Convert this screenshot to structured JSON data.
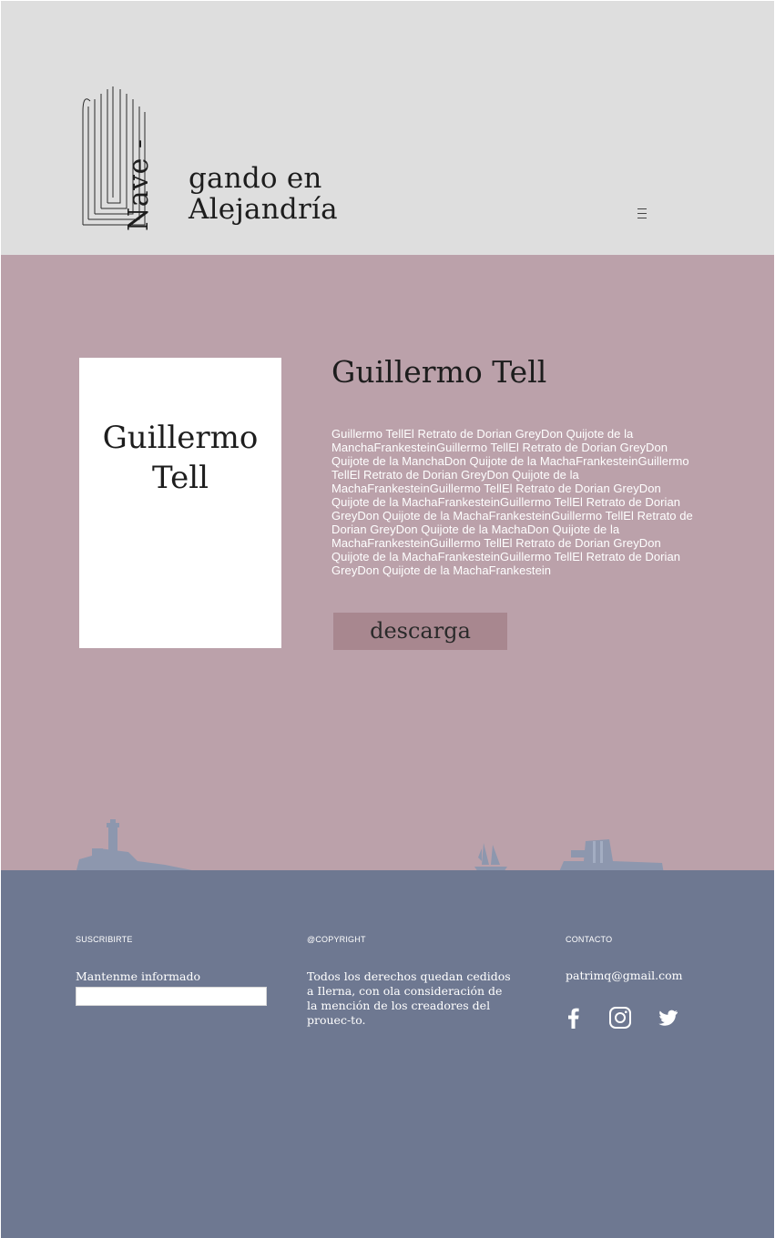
{
  "brand": {
    "vertical": "Nave -",
    "line1": "gando en",
    "line2": "Alejandría"
  },
  "book": {
    "cover_title": "Guillermo Tell",
    "title": "Guillermo Tell",
    "description": "Guillermo TellEl Retrato de Dorian GreyDon Quijote de la ManchaFrankesteinGuillermo TellEl Retrato de Dorian GreyDon Quijote de la ManchaDon Quijote de la MachaFrankesteinGuillermo TellEl Retrato de Dorian GreyDon Quijote de la MachaFrankesteinGuillermo TellEl Retrato de Dorian GreyDon Quijote de la MachaFrankesteinGuillermo TellEl Retrato de Dorian GreyDon Quijote de la MachaFrankesteinGuillermo TellEl Retrato de Dorian GreyDon Quijote de la MachaDon Quijote de la MachaFrankesteinGuillermo TellEl Retrato de Dorian GreyDon Quijote de la MachaFrankesteinGuillermo TellEl Retrato de Dorian GreyDon Quijote de la MachaFrankestein",
    "download_label": "descarga"
  },
  "footer": {
    "subscribe": {
      "heading": "SUSCRIBIRTE",
      "label": "Mantenme informado",
      "input_value": ""
    },
    "copyright": {
      "heading": "@COPYRIGHT",
      "text": "Todos los derechos quedan cedidos a Ilerna, con ola consideración de la mención de los creadores del prouec-to."
    },
    "contact": {
      "heading": "CONTACTO",
      "email": "patrimq@gmail.com"
    },
    "social": [
      "facebook-icon",
      "instagram-icon",
      "twitter-icon"
    ]
  },
  "colors": {
    "header_bg": "#dedede",
    "main_bg": "#bba1aa",
    "button_bg": "#a8878f",
    "footer_bg": "#6e7891",
    "skyline": "#8d97ae"
  }
}
